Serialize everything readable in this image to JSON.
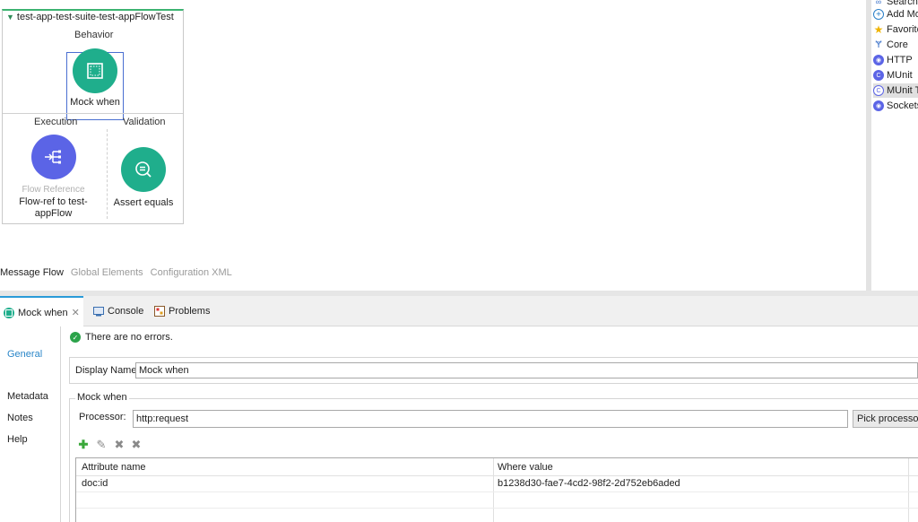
{
  "flow": {
    "title": "test-app-test-suite-test-appFlowTest",
    "behavior_label": "Behavior",
    "execution_label": "Execution",
    "validation_label": "Validation",
    "mock_when_label": "Mock when",
    "flow_ref_type": "Flow Reference",
    "flow_ref_label": "Flow-ref to test-appFlow",
    "assert_label": "Assert equals"
  },
  "palette": {
    "items": [
      {
        "label": "Search",
        "icon": "binoculars-icon"
      },
      {
        "label": "Add Mo",
        "icon": "add-circle-icon"
      },
      {
        "label": "Favorite",
        "icon": "star-icon"
      },
      {
        "label": "Core",
        "icon": "core-icon"
      },
      {
        "label": "HTTP",
        "icon": "http-module-icon"
      },
      {
        "label": "MUnit",
        "icon": "munit-module-icon"
      },
      {
        "label": "MUnit T",
        "icon": "munit-tools-module-icon"
      },
      {
        "label": "Sockets",
        "icon": "sockets-module-icon"
      }
    ]
  },
  "editor_tabs": {
    "message_flow": "Message Flow",
    "global_elements": "Global Elements",
    "configuration_xml": "Configuration XML"
  },
  "views": {
    "mock_when_tab": "Mock when",
    "console_tab": "Console",
    "problems_tab": "Problems"
  },
  "props": {
    "nav": {
      "general": "General",
      "metadata": "Metadata",
      "notes": "Notes",
      "help": "Help"
    },
    "status": "There are no errors.",
    "display_name_label": "Display Name:",
    "display_name_value": "Mock when",
    "group_title": "Mock when",
    "processor_label": "Processor:",
    "processor_value": "http:request",
    "pick_processor": "Pick processor",
    "table": {
      "headers": [
        "Attribute name",
        "Where value"
      ],
      "rows": [
        [
          "doc:id",
          "b1238d30-fae7-4cd2-98f2-2d752eb6aded"
        ]
      ]
    }
  },
  "colors": {
    "teal": "#1fae8c",
    "blue": "#5b64e6",
    "accent": "#2a9bd8"
  }
}
